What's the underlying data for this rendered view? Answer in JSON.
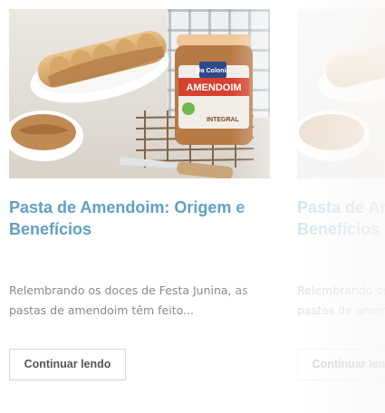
{
  "posts": [
    {
      "title": "Pasta de Amendoim: Origem e Benefícios",
      "excerpt": "Relembrando os doces de Festa Junina, as pastas de amendoim têm feito...",
      "button_label": "Continuar lendo",
      "jar_brand": "Da Colonia",
      "jar_product": "AMENDOIM",
      "jar_variant": "INTEGRAL"
    },
    {
      "title": "Pasta de Amendoim: Origem e Benefícios",
      "excerpt": "Relembrando os doces de Festa Junina, as pastas de amendoim têm feito...",
      "button_label": "Continuar lendo"
    }
  ],
  "colors": {
    "title": "#5f9fc8",
    "excerpt": "#8a8a8a",
    "button_border": "#d8d8d8",
    "button_text": "#555555"
  }
}
